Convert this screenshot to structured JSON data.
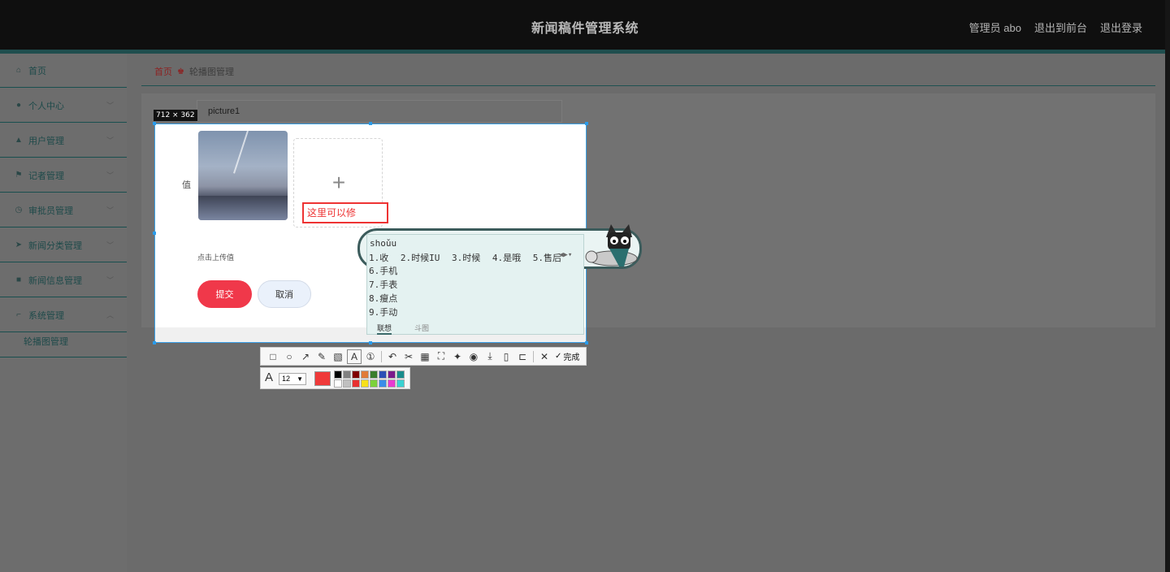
{
  "header": {
    "title": "新闻稿件管理系统",
    "links": [
      "管理员 abo",
      "退出到前台",
      "退出登录"
    ]
  },
  "sidebar": {
    "items": [
      {
        "label": "首页",
        "icon": "home-icon"
      },
      {
        "label": "个人中心",
        "icon": "user-icon"
      },
      {
        "label": "用户管理",
        "icon": "users-icon"
      },
      {
        "label": "记者管理",
        "icon": "flag-icon"
      },
      {
        "label": "审批员管理",
        "icon": "clock-icon"
      },
      {
        "label": "新闻分类管理",
        "icon": "send-icon"
      },
      {
        "label": "新闻信息管理",
        "icon": "box-icon"
      },
      {
        "label": "系统管理",
        "icon": "crop-icon"
      }
    ],
    "sub_item": "轮播图管理"
  },
  "breadcrumb": {
    "home": "首页",
    "current": "轮播图管理"
  },
  "form": {
    "name_value": "picture1",
    "value_label": "值",
    "upload_hint": "点击上传值",
    "submit": "提交",
    "cancel": "取消"
  },
  "screenshot_tool": {
    "size_badge": "712 × 362",
    "text_note": "这里可以修",
    "done_label": "完成",
    "font_size": "12",
    "current_color": "#ef3a3a",
    "palette": [
      "#000000",
      "#808080",
      "#800000",
      "#e07b39",
      "#3a7d2c",
      "#2b4fb5",
      "#7b1a8c",
      "#1a8c8c",
      "#ffffff",
      "#c0c0c0",
      "#e83030",
      "#f7e01a",
      "#7bd13a",
      "#3a8de8",
      "#e83ad1",
      "#3ad1d1"
    ]
  },
  "ime": {
    "composition": "shoǔu",
    "candidates_row1": [
      "1.收",
      "2.时候IU",
      "3.时候",
      "4.是哦",
      "5.售后"
    ],
    "candidates_more": [
      "6.手机",
      "7.手表",
      "8.瘦点",
      "9.手动"
    ],
    "tabs": [
      "联想",
      "斗图"
    ]
  }
}
